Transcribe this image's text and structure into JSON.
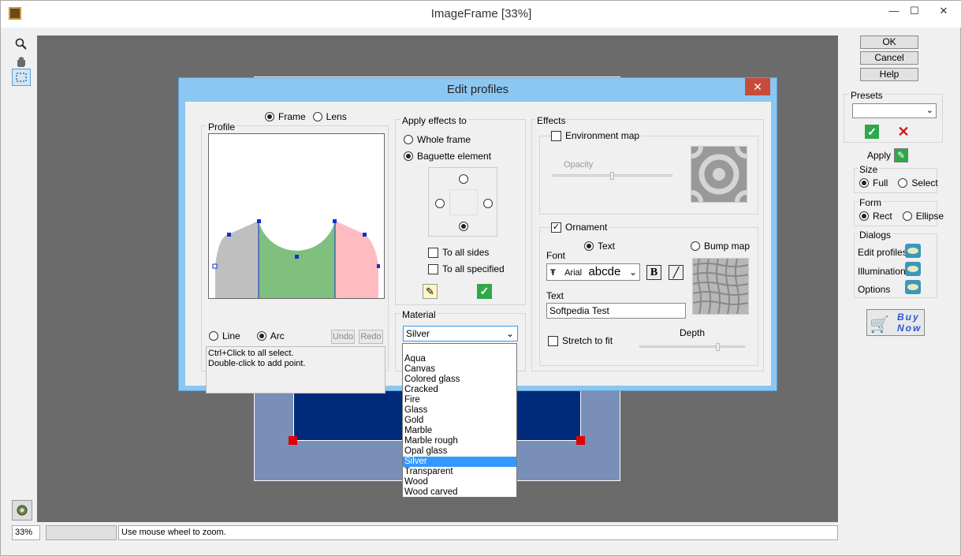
{
  "window": {
    "title": "ImageFrame [33%]",
    "min": "—",
    "max": "☐",
    "close": "✕"
  },
  "toolbar": {
    "zoom_icon": "magnifier-icon",
    "hand_icon": "hand-icon",
    "select_icon": "selection-icon"
  },
  "side": {
    "ok": "OK",
    "cancel": "Cancel",
    "help": "Help",
    "presets_label": "Presets",
    "apply_label": "Apply",
    "size_label": "Size",
    "size_full": "Full",
    "size_select": "Select",
    "form_label": "Form",
    "form_rect": "Rect",
    "form_ellipse": "Ellipse",
    "dialogs_label": "Dialogs",
    "dlg_edit_profiles": "Edit profiles",
    "dlg_illumination": "Illumination",
    "dlg_options": "Options",
    "buy_now_1": "Buy",
    "buy_now_2": "Now"
  },
  "dialog": {
    "title": "Edit profiles",
    "close": "✕",
    "frame": "Frame",
    "lens": "Lens",
    "profile_label": "Profile",
    "line": "Line",
    "arc": "Arc",
    "undo": "Undo",
    "redo": "Redo",
    "hint1": "Ctrl+Click to all select.",
    "hint2": "Double-click to add point.",
    "apply_effects_label": "Apply effects to",
    "whole_frame": "Whole frame",
    "baguette_element": "Baguette element",
    "to_all_sides": "To all sides",
    "to_all_specified": "To all specified",
    "material_label": "Material",
    "material_value": "Silver",
    "effects_label": "Effects",
    "environment_map": "Environment map",
    "opacity": "Opacity",
    "ornament": "Ornament",
    "text_opt": "Text",
    "bump_map": "Bump map",
    "font_label": "Font",
    "font_name": "Arial",
    "font_sample": "abcde",
    "text_label": "Text",
    "text_value": "Softpedia Test",
    "stretch_to_fit": "Stretch to fit",
    "depth": "Depth"
  },
  "materials": [
    "Aqua",
    "Canvas",
    "Colored glass",
    "Cracked",
    "Fire",
    "Glass",
    "Gold",
    "Marble",
    "Marble rough",
    "Opal glass",
    "Silver",
    "Transparent",
    "Wood",
    "Wood carved"
  ],
  "status": {
    "zoom": "33%",
    "message": "Use mouse wheel to zoom."
  },
  "colors": {
    "accent": "#3399ff",
    "titlebar": "#8cc7f1",
    "frame_blue": "#002b7a",
    "frame_gray": "#7a8fb8"
  }
}
